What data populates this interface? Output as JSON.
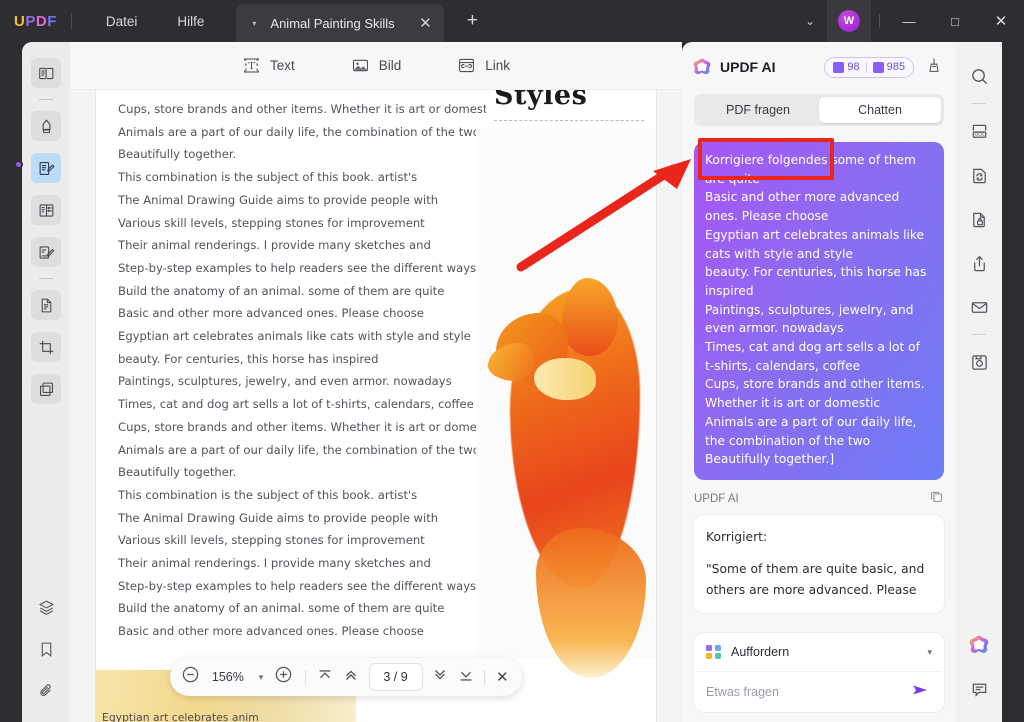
{
  "titlebar": {
    "logo": "UPDF",
    "menus": [
      "Datei",
      "Hilfe"
    ],
    "tab": {
      "title": "Animal Painting Skills",
      "close": "✕",
      "caret": "▾"
    },
    "new_tab": "+",
    "chevron": "⌄",
    "avatar_initial": "W",
    "minimize": "—",
    "maximize": "□",
    "close": "✕"
  },
  "toolbar": {
    "items": [
      {
        "label": "Text",
        "icon": "text-icon"
      },
      {
        "label": "Bild",
        "icon": "image-icon"
      },
      {
        "label": "Link",
        "icon": "link-icon"
      }
    ]
  },
  "left_rail": {
    "icons": [
      "reader-mode-icon",
      "highlight-icon",
      "edit-pdf-icon",
      "organize-pages-icon",
      "sign-icon",
      "form-icon",
      "crop-icon",
      "compare-icon",
      "layers-icon",
      "bookmark-icon",
      "attachment-icon"
    ]
  },
  "right_rail": {
    "icons": [
      "search-icon",
      "ocr-icon",
      "convert-icon",
      "protect-icon",
      "share-icon",
      "email-icon",
      "save-icon",
      "updf-ai-icon",
      "comment-icon"
    ]
  },
  "document": {
    "lines": [
      "Cups, store brands and other items. Whether it is art or domestic",
      "Animals are a part of our daily life, the combination of the two",
      "Beautifully together.",
      "This combination is the subject of this book. artist's",
      "The Animal Drawing Guide aims to provide people with",
      "Various skill levels, stepping stones for improvement",
      "Their animal renderings. I provide many sketches and",
      "Step-by-step examples to help readers see the different ways",
      "Build the anatomy of an animal. some of them are quite",
      "Basic and other more advanced ones. Please choose",
      "Egyptian art celebrates animals like cats with style and style",
      "beauty. For centuries, this horse has inspired",
      "Paintings, sculptures, jewelry, and even armor. nowadays",
      "Times, cat and dog art sells a lot of t-shirts, calendars, coffee",
      "Cups, store brands and other items. Whether it is art or domestic",
      "Animals are a part of our daily life, the combination of the two",
      "Beautifully together.",
      "This combination is the subject of this book. artist's",
      "The Animal Drawing Guide aims to provide people with",
      "Various skill levels, stepping stones for improvement",
      "Their animal renderings. I provide many sketches and",
      "Step-by-step examples to help readers see the different ways",
      "Build the anatomy of an animal. some of them are quite",
      "Basic and other more advanced ones. Please choose"
    ],
    "figure_heading": "Styles",
    "figure_caption": "Egyptian art celebrates anim"
  },
  "bottombar": {
    "zoom_out": "−",
    "zoom_level": "156%",
    "zoom_caret": "▾",
    "zoom_in": "+",
    "first_page": "first-page-icon",
    "prev_page": "prev-page-icon",
    "page_indicator": "3 / 9",
    "next_page": "next-page-icon",
    "last_page": "last-page-icon",
    "close": "✕"
  },
  "ai_panel": {
    "title": "UPDF AI",
    "credits": {
      "docs": "98",
      "messages": "985"
    },
    "broom": "clear-chat-icon",
    "tabs": [
      {
        "label": "PDF fragen",
        "active": false
      },
      {
        "label": "Chatten",
        "active": true
      }
    ],
    "user_message_lines": [
      "Korrigiere folgendes  some of them",
      "are quite",
      "Basic and other more advanced",
      "ones. Please choose",
      "Egyptian art celebrates animals like",
      "cats with style and style",
      "beauty. For centuries, this horse has",
      "inspired",
      "Paintings, sculptures, jewelry, and",
      "even armor. nowadays",
      "Times, cat and dog art sells a lot of",
      "t-shirts, calendars, coffee",
      "Cups, store brands and other items.",
      "Whether it is art or domestic",
      "Animals are a part of our daily life,",
      "the combination of the two",
      "Beautifully together.]"
    ],
    "assistant_label": "UPDF AI",
    "copy_icon": "copy-icon",
    "assistant_message": {
      "heading": "Korrigiert:",
      "body": "\"Some of them are quite basic, and others are more advanced. Please"
    },
    "prompt_button": {
      "label": "Auffordern",
      "caret": "▾",
      "icon": "prompt-grid-icon"
    },
    "ask_placeholder": "Etwas fragen",
    "ask_value": "",
    "send_icon": "send-icon"
  },
  "annotation": {
    "arrow": "red-arrow",
    "highlight_box": "red-highlight-box"
  },
  "colors": {
    "accent_purple": "#8b5cf6",
    "annotation_red": "#e8261c",
    "titlebar_bg": "#2e2d31",
    "panel_bg": "#f7f7f8"
  }
}
